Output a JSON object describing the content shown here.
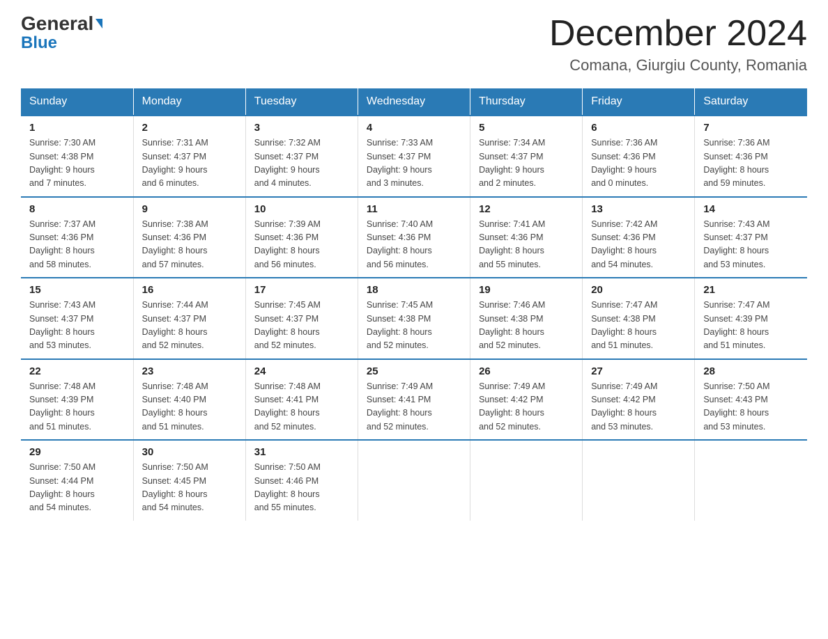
{
  "logo": {
    "general": "General",
    "blue": "Blue",
    "triangle": "▲"
  },
  "title": "December 2024",
  "location": "Comana, Giurgiu County, Romania",
  "days_of_week": [
    "Sunday",
    "Monday",
    "Tuesday",
    "Wednesday",
    "Thursday",
    "Friday",
    "Saturday"
  ],
  "weeks": [
    [
      {
        "day": "1",
        "sunrise": "7:30 AM",
        "sunset": "4:38 PM",
        "daylight": "9 hours and 7 minutes."
      },
      {
        "day": "2",
        "sunrise": "7:31 AM",
        "sunset": "4:37 PM",
        "daylight": "9 hours and 6 minutes."
      },
      {
        "day": "3",
        "sunrise": "7:32 AM",
        "sunset": "4:37 PM",
        "daylight": "9 hours and 4 minutes."
      },
      {
        "day": "4",
        "sunrise": "7:33 AM",
        "sunset": "4:37 PM",
        "daylight": "9 hours and 3 minutes."
      },
      {
        "day": "5",
        "sunrise": "7:34 AM",
        "sunset": "4:37 PM",
        "daylight": "9 hours and 2 minutes."
      },
      {
        "day": "6",
        "sunrise": "7:36 AM",
        "sunset": "4:36 PM",
        "daylight": "9 hours and 0 minutes."
      },
      {
        "day": "7",
        "sunrise": "7:36 AM",
        "sunset": "4:36 PM",
        "daylight": "8 hours and 59 minutes."
      }
    ],
    [
      {
        "day": "8",
        "sunrise": "7:37 AM",
        "sunset": "4:36 PM",
        "daylight": "8 hours and 58 minutes."
      },
      {
        "day": "9",
        "sunrise": "7:38 AM",
        "sunset": "4:36 PM",
        "daylight": "8 hours and 57 minutes."
      },
      {
        "day": "10",
        "sunrise": "7:39 AM",
        "sunset": "4:36 PM",
        "daylight": "8 hours and 56 minutes."
      },
      {
        "day": "11",
        "sunrise": "7:40 AM",
        "sunset": "4:36 PM",
        "daylight": "8 hours and 56 minutes."
      },
      {
        "day": "12",
        "sunrise": "7:41 AM",
        "sunset": "4:36 PM",
        "daylight": "8 hours and 55 minutes."
      },
      {
        "day": "13",
        "sunrise": "7:42 AM",
        "sunset": "4:36 PM",
        "daylight": "8 hours and 54 minutes."
      },
      {
        "day": "14",
        "sunrise": "7:43 AM",
        "sunset": "4:37 PM",
        "daylight": "8 hours and 53 minutes."
      }
    ],
    [
      {
        "day": "15",
        "sunrise": "7:43 AM",
        "sunset": "4:37 PM",
        "daylight": "8 hours and 53 minutes."
      },
      {
        "day": "16",
        "sunrise": "7:44 AM",
        "sunset": "4:37 PM",
        "daylight": "8 hours and 52 minutes."
      },
      {
        "day": "17",
        "sunrise": "7:45 AM",
        "sunset": "4:37 PM",
        "daylight": "8 hours and 52 minutes."
      },
      {
        "day": "18",
        "sunrise": "7:45 AM",
        "sunset": "4:38 PM",
        "daylight": "8 hours and 52 minutes."
      },
      {
        "day": "19",
        "sunrise": "7:46 AM",
        "sunset": "4:38 PM",
        "daylight": "8 hours and 52 minutes."
      },
      {
        "day": "20",
        "sunrise": "7:47 AM",
        "sunset": "4:38 PM",
        "daylight": "8 hours and 51 minutes."
      },
      {
        "day": "21",
        "sunrise": "7:47 AM",
        "sunset": "4:39 PM",
        "daylight": "8 hours and 51 minutes."
      }
    ],
    [
      {
        "day": "22",
        "sunrise": "7:48 AM",
        "sunset": "4:39 PM",
        "daylight": "8 hours and 51 minutes."
      },
      {
        "day": "23",
        "sunrise": "7:48 AM",
        "sunset": "4:40 PM",
        "daylight": "8 hours and 51 minutes."
      },
      {
        "day": "24",
        "sunrise": "7:48 AM",
        "sunset": "4:41 PM",
        "daylight": "8 hours and 52 minutes."
      },
      {
        "day": "25",
        "sunrise": "7:49 AM",
        "sunset": "4:41 PM",
        "daylight": "8 hours and 52 minutes."
      },
      {
        "day": "26",
        "sunrise": "7:49 AM",
        "sunset": "4:42 PM",
        "daylight": "8 hours and 52 minutes."
      },
      {
        "day": "27",
        "sunrise": "7:49 AM",
        "sunset": "4:42 PM",
        "daylight": "8 hours and 53 minutes."
      },
      {
        "day": "28",
        "sunrise": "7:50 AM",
        "sunset": "4:43 PM",
        "daylight": "8 hours and 53 minutes."
      }
    ],
    [
      {
        "day": "29",
        "sunrise": "7:50 AM",
        "sunset": "4:44 PM",
        "daylight": "8 hours and 54 minutes."
      },
      {
        "day": "30",
        "sunrise": "7:50 AM",
        "sunset": "4:45 PM",
        "daylight": "8 hours and 54 minutes."
      },
      {
        "day": "31",
        "sunrise": "7:50 AM",
        "sunset": "4:46 PM",
        "daylight": "8 hours and 55 minutes."
      },
      null,
      null,
      null,
      null
    ]
  ],
  "labels": {
    "sunrise": "Sunrise:",
    "sunset": "Sunset:",
    "daylight": "Daylight:"
  }
}
